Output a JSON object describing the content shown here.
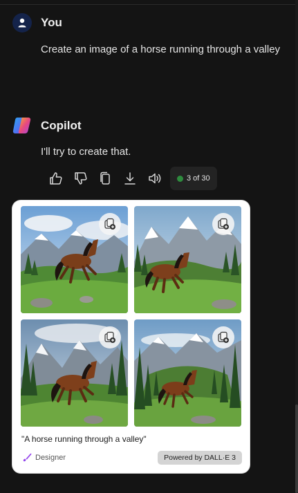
{
  "user": {
    "name": "You",
    "message": "Create an image of a horse running through a valley"
  },
  "copilot": {
    "name": "Copilot",
    "message": "I'll try to create that.",
    "counter": "3 of 30",
    "counter_color": "#2e8b3e"
  },
  "actions": [
    {
      "icon": "thumbs-up-icon"
    },
    {
      "icon": "thumbs-down-icon"
    },
    {
      "icon": "copy-icon"
    },
    {
      "icon": "download-icon"
    },
    {
      "icon": "speaker-icon"
    }
  ],
  "image_card": {
    "images": [
      {
        "description": "horse galloping in green valley with mountains",
        "action_icon": "copy-to-collection-icon"
      },
      {
        "description": "horse running in meadow below snowy peaks",
        "action_icon": "copy-to-collection-icon"
      },
      {
        "description": "horse running among pine trees and mountains",
        "action_icon": "copy-to-collection-icon"
      },
      {
        "description": "horse running through forested valley",
        "action_icon": "copy-to-collection-icon"
      }
    ],
    "caption": "\"A horse running through a valley\"",
    "designer_label": "Designer",
    "powered_by": "Powered by DALL·E 3"
  }
}
